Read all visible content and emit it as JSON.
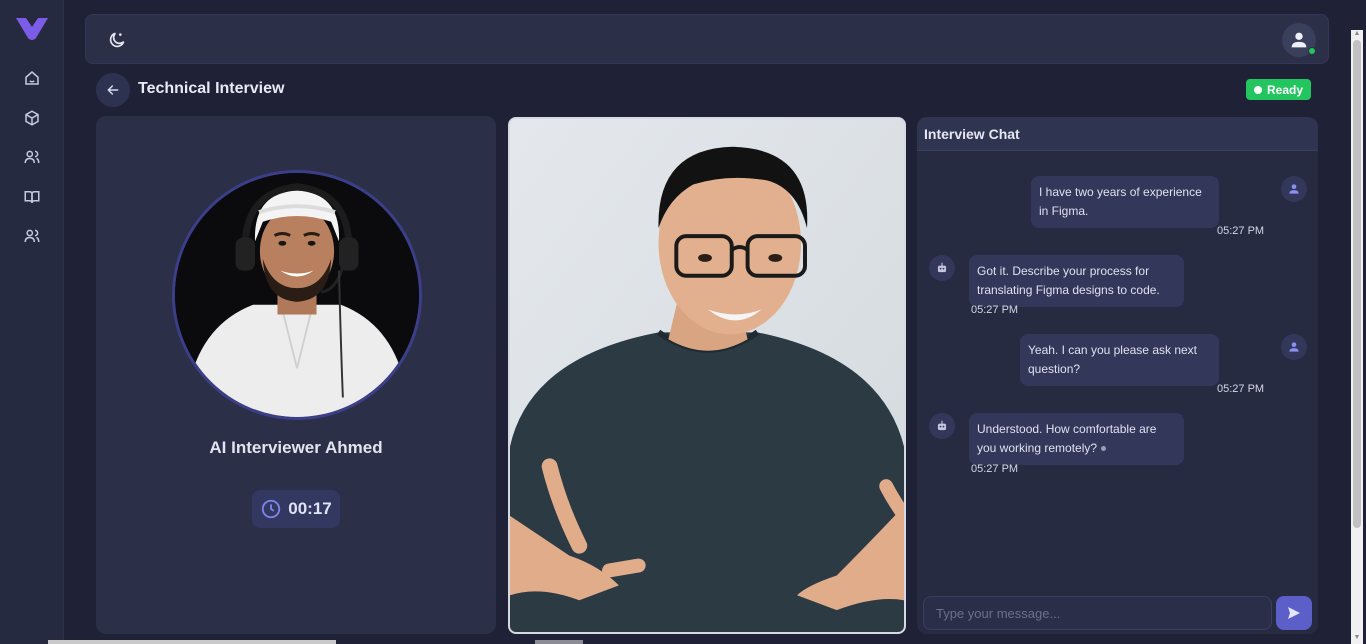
{
  "app": {
    "brand_color": "#6d5bd6",
    "accent": "#5b5fc7",
    "status_color": "#22c55e"
  },
  "sidebar": {
    "items": [
      {
        "icon": "home-icon"
      },
      {
        "icon": "cube-icon"
      },
      {
        "icon": "users-icon"
      },
      {
        "icon": "book-icon"
      },
      {
        "icon": "team-icon"
      }
    ]
  },
  "topbar": {
    "theme_icon": "moon-icon",
    "user_icon": "user-icon"
  },
  "page": {
    "title": "Technical Interview",
    "status": "Ready"
  },
  "interviewer": {
    "name": "AI Interviewer Ahmed",
    "timer": "00:17"
  },
  "chat": {
    "title": "Interview Chat",
    "messages": [
      {
        "sender": "user",
        "text_line1": "I have two years of experience",
        "text_line2": "in Figma.",
        "time": "05:27 PM"
      },
      {
        "sender": "bot",
        "text_line1": "Got it. Describe your process for",
        "text_line2": "translating Figma designs to code.",
        "time": "05:27 PM"
      },
      {
        "sender": "user",
        "text_line1": "Yeah. I can you please ask next",
        "text_line2": "question?",
        "time": "05:27 PM"
      },
      {
        "sender": "bot",
        "text_line1": "Understood. How comfortable are",
        "text_line2": "you working remotely?",
        "time": "05:27 PM"
      }
    ],
    "input_placeholder": "Type your message...",
    "input_value": ""
  }
}
